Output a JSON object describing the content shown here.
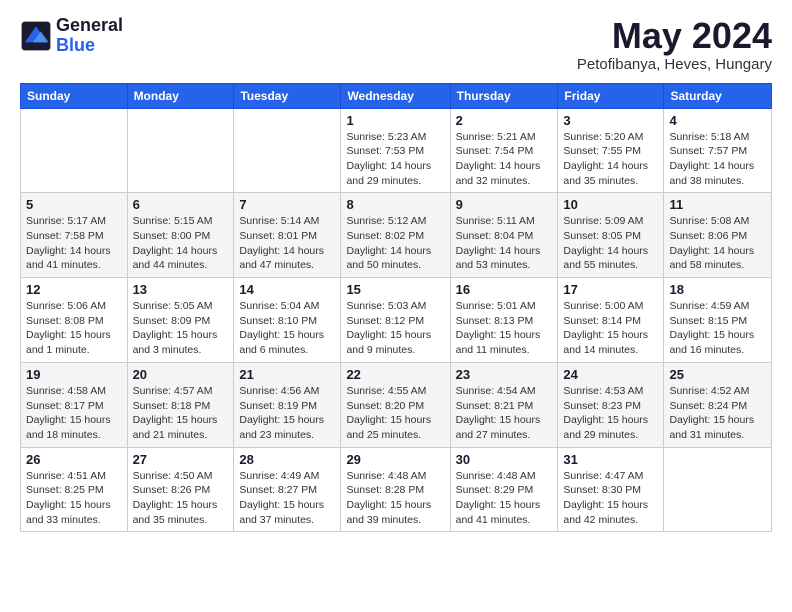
{
  "logo": {
    "general": "General",
    "blue": "Blue"
  },
  "title": {
    "month_year": "May 2024",
    "location": "Petofibanya, Heves, Hungary"
  },
  "headers": [
    "Sunday",
    "Monday",
    "Tuesday",
    "Wednesday",
    "Thursday",
    "Friday",
    "Saturday"
  ],
  "weeks": [
    [
      {
        "day": "",
        "info": ""
      },
      {
        "day": "",
        "info": ""
      },
      {
        "day": "",
        "info": ""
      },
      {
        "day": "1",
        "info": "Sunrise: 5:23 AM\nSunset: 7:53 PM\nDaylight: 14 hours\nand 29 minutes."
      },
      {
        "day": "2",
        "info": "Sunrise: 5:21 AM\nSunset: 7:54 PM\nDaylight: 14 hours\nand 32 minutes."
      },
      {
        "day": "3",
        "info": "Sunrise: 5:20 AM\nSunset: 7:55 PM\nDaylight: 14 hours\nand 35 minutes."
      },
      {
        "day": "4",
        "info": "Sunrise: 5:18 AM\nSunset: 7:57 PM\nDaylight: 14 hours\nand 38 minutes."
      }
    ],
    [
      {
        "day": "5",
        "info": "Sunrise: 5:17 AM\nSunset: 7:58 PM\nDaylight: 14 hours\nand 41 minutes."
      },
      {
        "day": "6",
        "info": "Sunrise: 5:15 AM\nSunset: 8:00 PM\nDaylight: 14 hours\nand 44 minutes."
      },
      {
        "day": "7",
        "info": "Sunrise: 5:14 AM\nSunset: 8:01 PM\nDaylight: 14 hours\nand 47 minutes."
      },
      {
        "day": "8",
        "info": "Sunrise: 5:12 AM\nSunset: 8:02 PM\nDaylight: 14 hours\nand 50 minutes."
      },
      {
        "day": "9",
        "info": "Sunrise: 5:11 AM\nSunset: 8:04 PM\nDaylight: 14 hours\nand 53 minutes."
      },
      {
        "day": "10",
        "info": "Sunrise: 5:09 AM\nSunset: 8:05 PM\nDaylight: 14 hours\nand 55 minutes."
      },
      {
        "day": "11",
        "info": "Sunrise: 5:08 AM\nSunset: 8:06 PM\nDaylight: 14 hours\nand 58 minutes."
      }
    ],
    [
      {
        "day": "12",
        "info": "Sunrise: 5:06 AM\nSunset: 8:08 PM\nDaylight: 15 hours\nand 1 minute."
      },
      {
        "day": "13",
        "info": "Sunrise: 5:05 AM\nSunset: 8:09 PM\nDaylight: 15 hours\nand 3 minutes."
      },
      {
        "day": "14",
        "info": "Sunrise: 5:04 AM\nSunset: 8:10 PM\nDaylight: 15 hours\nand 6 minutes."
      },
      {
        "day": "15",
        "info": "Sunrise: 5:03 AM\nSunset: 8:12 PM\nDaylight: 15 hours\nand 9 minutes."
      },
      {
        "day": "16",
        "info": "Sunrise: 5:01 AM\nSunset: 8:13 PM\nDaylight: 15 hours\nand 11 minutes."
      },
      {
        "day": "17",
        "info": "Sunrise: 5:00 AM\nSunset: 8:14 PM\nDaylight: 15 hours\nand 14 minutes."
      },
      {
        "day": "18",
        "info": "Sunrise: 4:59 AM\nSunset: 8:15 PM\nDaylight: 15 hours\nand 16 minutes."
      }
    ],
    [
      {
        "day": "19",
        "info": "Sunrise: 4:58 AM\nSunset: 8:17 PM\nDaylight: 15 hours\nand 18 minutes."
      },
      {
        "day": "20",
        "info": "Sunrise: 4:57 AM\nSunset: 8:18 PM\nDaylight: 15 hours\nand 21 minutes."
      },
      {
        "day": "21",
        "info": "Sunrise: 4:56 AM\nSunset: 8:19 PM\nDaylight: 15 hours\nand 23 minutes."
      },
      {
        "day": "22",
        "info": "Sunrise: 4:55 AM\nSunset: 8:20 PM\nDaylight: 15 hours\nand 25 minutes."
      },
      {
        "day": "23",
        "info": "Sunrise: 4:54 AM\nSunset: 8:21 PM\nDaylight: 15 hours\nand 27 minutes."
      },
      {
        "day": "24",
        "info": "Sunrise: 4:53 AM\nSunset: 8:23 PM\nDaylight: 15 hours\nand 29 minutes."
      },
      {
        "day": "25",
        "info": "Sunrise: 4:52 AM\nSunset: 8:24 PM\nDaylight: 15 hours\nand 31 minutes."
      }
    ],
    [
      {
        "day": "26",
        "info": "Sunrise: 4:51 AM\nSunset: 8:25 PM\nDaylight: 15 hours\nand 33 minutes."
      },
      {
        "day": "27",
        "info": "Sunrise: 4:50 AM\nSunset: 8:26 PM\nDaylight: 15 hours\nand 35 minutes."
      },
      {
        "day": "28",
        "info": "Sunrise: 4:49 AM\nSunset: 8:27 PM\nDaylight: 15 hours\nand 37 minutes."
      },
      {
        "day": "29",
        "info": "Sunrise: 4:48 AM\nSunset: 8:28 PM\nDaylight: 15 hours\nand 39 minutes."
      },
      {
        "day": "30",
        "info": "Sunrise: 4:48 AM\nSunset: 8:29 PM\nDaylight: 15 hours\nand 41 minutes."
      },
      {
        "day": "31",
        "info": "Sunrise: 4:47 AM\nSunset: 8:30 PM\nDaylight: 15 hours\nand 42 minutes."
      },
      {
        "day": "",
        "info": ""
      }
    ]
  ]
}
